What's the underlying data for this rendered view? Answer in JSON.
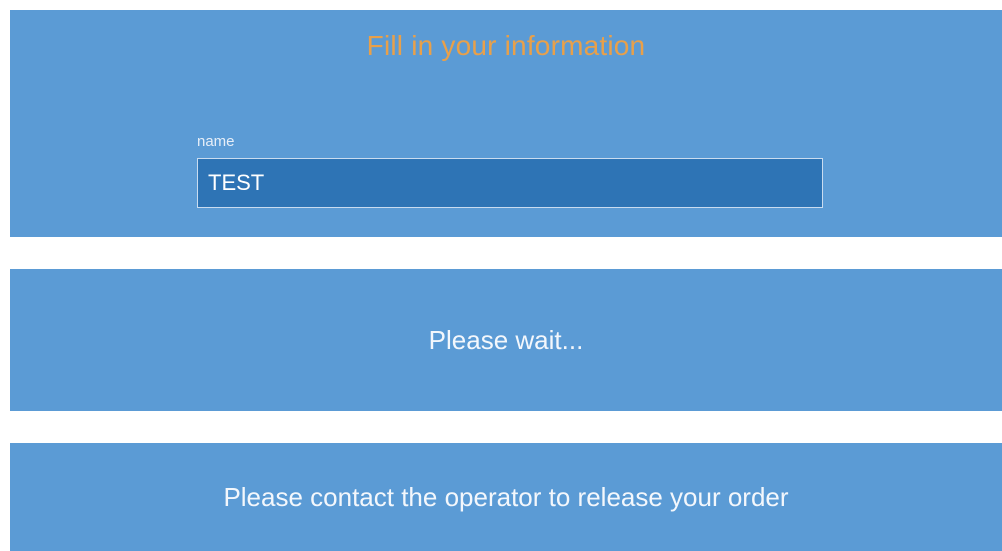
{
  "form": {
    "title": "Fill in your information",
    "name_label": "name",
    "name_value": "TEST"
  },
  "status": {
    "wait_message": "Please wait...",
    "contact_message": "Please contact the operator to release your order"
  },
  "colors": {
    "panel_background": "#5b9bd5",
    "input_background": "#2e74b5",
    "title_accent": "#e8a04a",
    "page_background": "#ffffff"
  }
}
